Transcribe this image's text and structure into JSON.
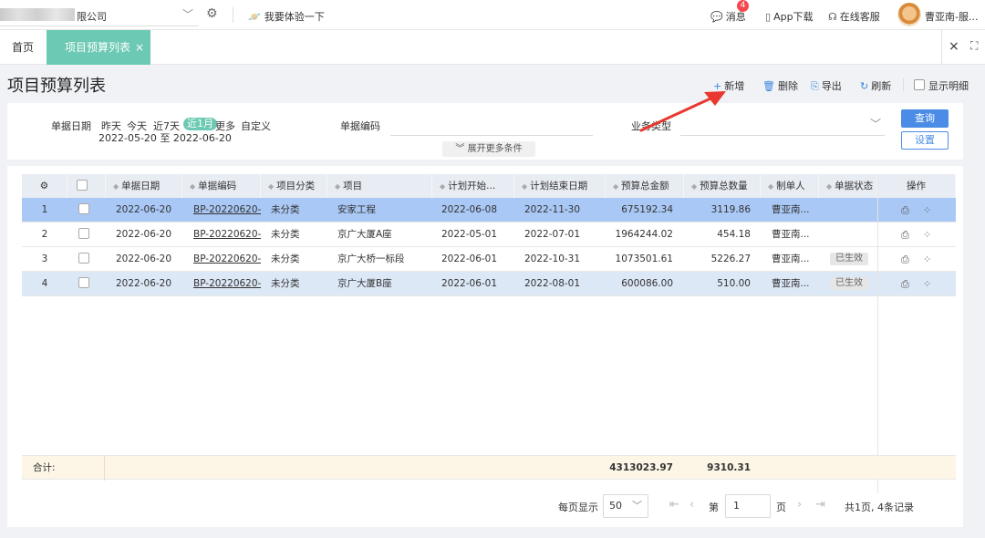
{
  "header": {
    "company_suffix": "限公司",
    "try_label": "我要体验一下",
    "messages_label": "消息",
    "messages_badge": "4",
    "app_download": "App下载",
    "online_service": "在线客服",
    "user_name": "曹亚南-服..."
  },
  "tabs": {
    "home": "首页",
    "active": "项目预算列表",
    "active_close": "×",
    "close_all": "×",
    "fullscreen": "⛶"
  },
  "page": {
    "title": "项目预算列表",
    "actions": {
      "add": "新增",
      "delete": "删除",
      "export": "导出",
      "refresh": "刷新",
      "show_detail": "显示明细"
    }
  },
  "filter": {
    "date_label": "单据日期",
    "date_options": [
      "昨天",
      "今天",
      "近7天",
      "近1月",
      "更多",
      "自定义"
    ],
    "date_range": "2022-05-20 至 2022-06-20",
    "code_label": "单据编码",
    "biz_type_label": "业务类型",
    "query": "查询",
    "reset": "设置",
    "expand": "展开更多条件"
  },
  "table": {
    "columns": [
      "单据日期",
      "单据编码",
      "项目分类",
      "项目",
      "计划开始...",
      "计划结束日期",
      "预算总金额",
      "预算总数量",
      "制单人",
      "单据状态",
      "操作"
    ],
    "rows": [
      {
        "idx": "1",
        "date": "2022-06-20",
        "code": "BP-20220620-",
        "cat": "未分类",
        "project": "安家工程",
        "start": "2022-06-08",
        "end": "2022-11-30",
        "amount": "675192.34",
        "qty": "3119.86",
        "maker": "曹亚南...",
        "status": ""
      },
      {
        "idx": "2",
        "date": "2022-06-20",
        "code": "BP-20220620-",
        "cat": "未分类",
        "project": "京广大厦A座",
        "start": "2022-05-01",
        "end": "2022-07-01",
        "amount": "1964244.02",
        "qty": "454.18",
        "maker": "曹亚南...",
        "status": ""
      },
      {
        "idx": "3",
        "date": "2022-06-20",
        "code": "BP-20220620-",
        "cat": "未分类",
        "project": "京广大桥一标段",
        "start": "2022-06-01",
        "end": "2022-10-31",
        "amount": "1073501.61",
        "qty": "5226.27",
        "maker": "曹亚南...",
        "status": "已生效"
      },
      {
        "idx": "4",
        "date": "2022-06-20",
        "code": "BP-20220620-",
        "cat": "未分类",
        "project": "京广大厦B座",
        "start": "2022-06-01",
        "end": "2022-08-01",
        "amount": "600086.00",
        "qty": "510.00",
        "maker": "曹亚南...",
        "status": "已生效"
      }
    ],
    "total_label": "合计:",
    "total_amount": "4313023.97",
    "total_qty": "9310.31"
  },
  "pager": {
    "per_page_label": "每页显示",
    "per_page": "50",
    "page_prefix": "第",
    "page_value": "1",
    "page_suffix": "页",
    "summary": "共1页, 4条记录"
  },
  "colors": {
    "accent_green": "#6cc9b3",
    "primary_blue": "#4a8ce6",
    "arrow_red": "#e8382f"
  }
}
